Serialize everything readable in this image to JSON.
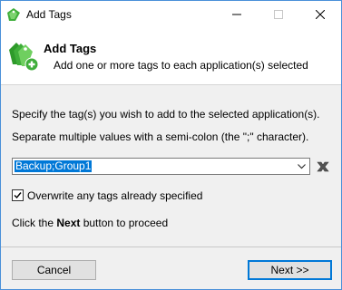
{
  "window": {
    "title": "Add Tags"
  },
  "banner": {
    "heading": "Add Tags",
    "subheading": "Add one or more tags to each application(s) selected"
  },
  "body": {
    "instruction": "Specify the tag(s) you wish to add to the selected application(s).",
    "separator_hint": "Separate multiple values with a semi-colon (the \";\" character).",
    "tags_value": "Backup;Group1",
    "overwrite_label": "Overwrite any tags already specified",
    "overwrite_checked": true,
    "proceed_prefix": "Click the ",
    "proceed_bold": "Next",
    "proceed_suffix": " button to proceed"
  },
  "buttons": {
    "cancel": "Cancel",
    "next": "Next >>"
  },
  "colors": {
    "accent": "#0078d7",
    "icon_green": "#3fae3a",
    "clear_icon": "#555555"
  },
  "icons": {
    "app": "tags-icon",
    "banner": "tags-add-icon",
    "clear": "clear-x-icon",
    "dropdown": "chevron-down-icon"
  }
}
